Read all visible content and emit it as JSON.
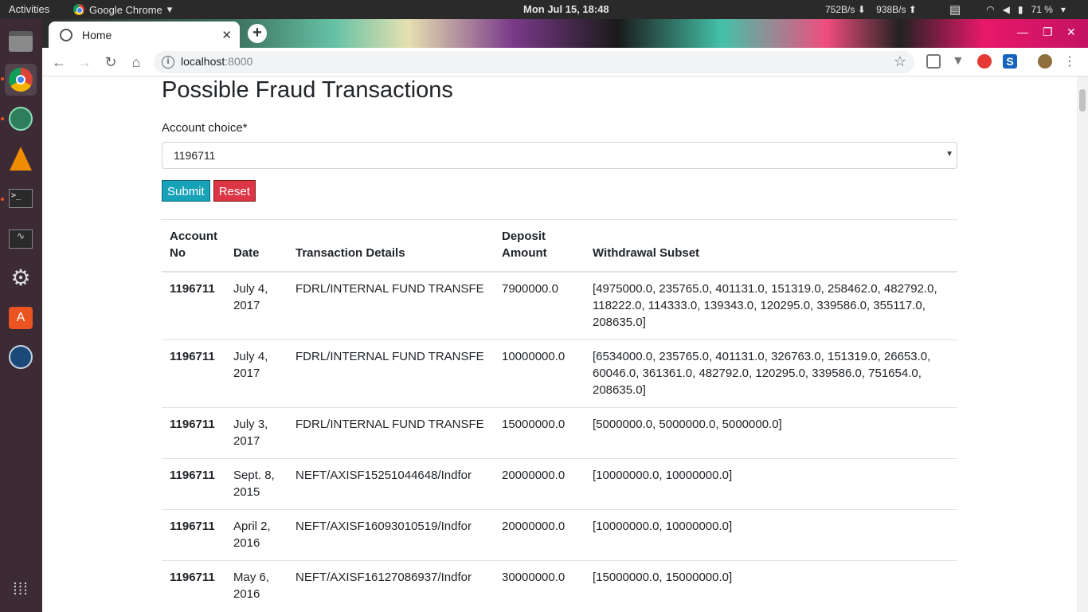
{
  "system": {
    "activities": "Activities",
    "app_name": "Google Chrome",
    "clock": "Mon Jul 15, 18:48",
    "down_speed": "752B/s",
    "up_speed": "938B/s",
    "battery": "71 %"
  },
  "browser": {
    "tab_title": "Home",
    "url_host": "localhost",
    "url_port": ":8000"
  },
  "page": {
    "title": "Possible Fraud Transactions",
    "account_label": "Account choice*",
    "account_value": "1196711",
    "submit_label": "Submit",
    "reset_label": "Reset",
    "columns": [
      "Account No",
      "Date",
      "Transaction Details",
      "Deposit Amount",
      "Withdrawal Subset"
    ],
    "rows": [
      {
        "account": "1196711",
        "date": "July 4, 2017",
        "details": "FDRL/INTERNAL FUND TRANSFE",
        "deposit": "7900000.0",
        "subset": "[4975000.0, 235765.0, 401131.0, 151319.0, 258462.0, 482792.0, 118222.0, 114333.0, 139343.0, 120295.0, 339586.0, 355117.0, 208635.0]"
      },
      {
        "account": "1196711",
        "date": "July 4, 2017",
        "details": "FDRL/INTERNAL FUND TRANSFE",
        "deposit": "10000000.0",
        "subset": "[6534000.0, 235765.0, 401131.0, 326763.0, 151319.0, 26653.0, 60046.0, 361361.0, 482792.0, 120295.0, 339586.0, 751654.0, 208635.0]"
      },
      {
        "account": "1196711",
        "date": "July 3, 2017",
        "details": "FDRL/INTERNAL FUND TRANSFE",
        "deposit": "15000000.0",
        "subset": "[5000000.0, 5000000.0, 5000000.0]"
      },
      {
        "account": "1196711",
        "date": "Sept. 8, 2015",
        "details": "NEFT/AXISF15251044648/Indfor",
        "deposit": "20000000.0",
        "subset": "[10000000.0, 10000000.0]"
      },
      {
        "account": "1196711",
        "date": "April 2, 2016",
        "details": "NEFT/AXISF16093010519/Indfor",
        "deposit": "20000000.0",
        "subset": "[10000000.0, 10000000.0]"
      },
      {
        "account": "1196711",
        "date": "May 6, 2016",
        "details": "NEFT/AXISF16127086937/Indfor",
        "deposit": "30000000.0",
        "subset": "[15000000.0, 15000000.0]"
      }
    ]
  }
}
